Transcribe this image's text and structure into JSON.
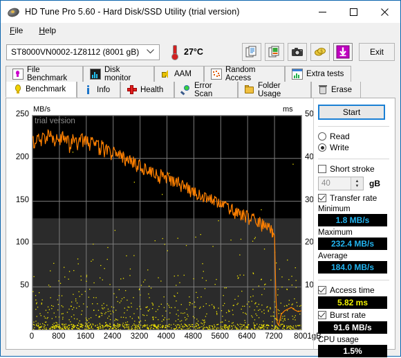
{
  "window": {
    "title": "HD Tune Pro 5.60 - Hard Disk/SSD Utility (trial version)",
    "minimize": "─",
    "maximize": "□",
    "close": "✕"
  },
  "menu": {
    "items": [
      "File",
      "Help"
    ]
  },
  "toolbar": {
    "drive": "ST8000VN0002-1Z8112 (8001 gB)",
    "caret": "⌄",
    "temperature": "27°C",
    "exit_label": "Exit",
    "buttons": [
      {
        "name": "copy-text-icon"
      },
      {
        "name": "copy-image-icon"
      },
      {
        "name": "screenshot-icon"
      },
      {
        "name": "donate-icon"
      },
      {
        "name": "download-icon"
      }
    ]
  },
  "tabs": {
    "row1": [
      {
        "label": "File Benchmark",
        "icon": "file-benchmark-icon"
      },
      {
        "label": "Disk monitor",
        "icon": "disk-monitor-icon"
      },
      {
        "label": "AAM",
        "icon": "aam-icon"
      },
      {
        "label": "Random Access",
        "icon": "random-access-icon"
      },
      {
        "label": "Extra tests",
        "icon": "extra-tests-icon"
      }
    ],
    "row2": [
      {
        "label": "Benchmark",
        "icon": "benchmark-icon",
        "active": true
      },
      {
        "label": "Info",
        "icon": "info-icon"
      },
      {
        "label": "Health",
        "icon": "health-icon"
      },
      {
        "label": "Error Scan",
        "icon": "error-scan-icon"
      },
      {
        "label": "Folder Usage",
        "icon": "folder-usage-icon"
      },
      {
        "label": "Erase",
        "icon": "erase-icon"
      }
    ]
  },
  "results": {
    "start_label": "Start",
    "mode": {
      "read": "Read",
      "write": "Write",
      "selected": "Write"
    },
    "short_stroke": {
      "label": "Short stroke",
      "checked": false,
      "value": "40",
      "unit": "gB"
    },
    "transfer_rate": {
      "label": "Transfer rate",
      "checked": true
    },
    "minimum": {
      "label": "Minimum",
      "value": "1.8 MB/s"
    },
    "maximum": {
      "label": "Maximum",
      "value": "232.4 MB/s"
    },
    "average": {
      "label": "Average",
      "value": "184.0 MB/s"
    },
    "access_time": {
      "label": "Access time",
      "checked": true,
      "value": "5.82 ms"
    },
    "burst_rate": {
      "label": "Burst rate",
      "checked": true,
      "value": "91.6 MB/s"
    },
    "cpu_usage": {
      "label": "CPU usage",
      "value": "1.5%"
    },
    "colors": {
      "transfer": "#22b4f0",
      "access": "#f2f200",
      "plain": "#ffffff",
      "accent": "#1a7fd4"
    }
  },
  "chart_data": {
    "type": "line",
    "title": "",
    "watermark": "trial version",
    "xlabel": "gB",
    "ylabel": "MB/s",
    "y2label": "ms",
    "xlim": [
      0,
      8001
    ],
    "ylim": [
      0,
      250
    ],
    "y2lim": [
      0,
      50
    ],
    "grid": true,
    "x_ticks": [
      "0",
      "800",
      "1600",
      "2400",
      "3200",
      "4000",
      "4800",
      "5600",
      "6400",
      "7200",
      "8001gB"
    ],
    "x_tick_values": [
      0,
      800,
      1600,
      2400,
      3200,
      4000,
      4800,
      5600,
      6400,
      7200,
      8001
    ],
    "y_ticks": [
      "50",
      "100",
      "150",
      "200",
      "250"
    ],
    "y_tick_values": [
      50,
      100,
      150,
      200,
      250
    ],
    "y2_ticks": [
      "10",
      "20",
      "30",
      "40",
      "50"
    ],
    "y2_tick_values": [
      10,
      20,
      30,
      40,
      50
    ],
    "series": [
      {
        "name": "Transfer rate",
        "color": "#ff8000",
        "unit": "MB/s",
        "axis": "left",
        "x": [
          0,
          80,
          160,
          240,
          320,
          400,
          480,
          560,
          640,
          720,
          800,
          880,
          960,
          1040,
          1120,
          1200,
          1280,
          1360,
          1440,
          1520,
          1600,
          1680,
          1760,
          1840,
          1920,
          2000,
          2080,
          2160,
          2240,
          2320,
          2400,
          2480,
          2560,
          2640,
          2720,
          2800,
          2880,
          2960,
          3040,
          3120,
          3200,
          3280,
          3360,
          3440,
          3520,
          3600,
          3680,
          3760,
          3840,
          3920,
          4000,
          4080,
          4160,
          4240,
          4320,
          4400,
          4480,
          4560,
          4640,
          4720,
          4800,
          4880,
          4960,
          5040,
          5120,
          5200,
          5280,
          5360,
          5440,
          5520,
          5600,
          5680,
          5760,
          5840,
          5920,
          6000,
          6080,
          6160,
          6240,
          6320,
          6400,
          6480,
          6560,
          6640,
          6720,
          6800,
          6880,
          6960,
          7040,
          7120,
          7160,
          7200,
          7240,
          7280,
          7320,
          7400,
          7500,
          7600,
          7700,
          7800,
          7900,
          8001
        ],
        "y": [
          224,
          218,
          226,
          222,
          229,
          220,
          232,
          226,
          221,
          228,
          223,
          230,
          219,
          226,
          213,
          228,
          224,
          217,
          227,
          221,
          225,
          218,
          222,
          215,
          220,
          212,
          217,
          209,
          214,
          206,
          211,
          203,
          208,
          200,
          205,
          197,
          202,
          194,
          199,
          191,
          196,
          188,
          193,
          185,
          190,
          182,
          187,
          179,
          184,
          176,
          181,
          173,
          178,
          170,
          175,
          167,
          172,
          164,
          169,
          161,
          166,
          158,
          163,
          155,
          160,
          152,
          157,
          149,
          154,
          146,
          151,
          143,
          148,
          140,
          145,
          137,
          142,
          134,
          139,
          131,
          136,
          128,
          133,
          125,
          130,
          122,
          127,
          119,
          124,
          116,
          113,
          110,
          40,
          8,
          5,
          18,
          22,
          24,
          26,
          23,
          21,
          22
        ]
      },
      {
        "name": "Access time",
        "color": "#f2f200",
        "unit": "ms",
        "axis": "right",
        "note": "scatter cloud of per-seek access times, mostly 0-12 ms with occasional outliers up to 40 ms"
      }
    ]
  }
}
